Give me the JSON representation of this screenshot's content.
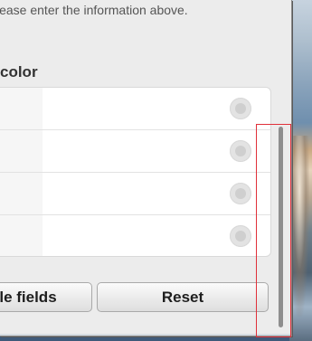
{
  "form": {
    "info_text": "lease enter the information above.",
    "section_label": "color"
  },
  "color_list": {
    "rows": [
      {
        "selected": false
      },
      {
        "selected": false
      },
      {
        "selected": false
      },
      {
        "selected": false
      }
    ]
  },
  "buttons": {
    "left_label": "le fields",
    "reset_label": "Reset"
  },
  "colors": {
    "window_bg": "#ececec",
    "highlight": "#e0303a",
    "scroll_thumb": "#8e8e8e"
  }
}
